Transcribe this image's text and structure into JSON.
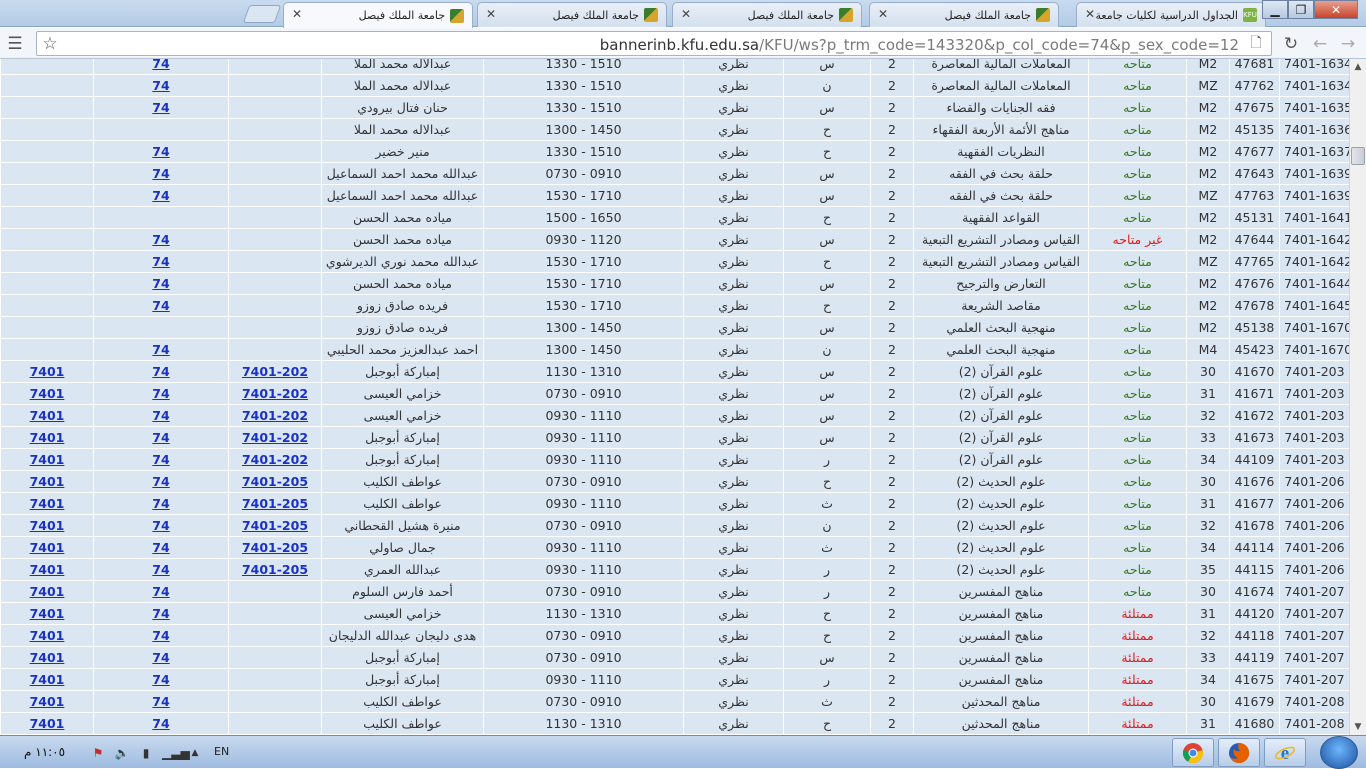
{
  "browser": {
    "tabs": [
      {
        "title": "الجداول الدراسية لكليات جامعة",
        "icon": "kfu-icon",
        "active": false
      },
      {
        "title": "جامعة الملك فيصل",
        "icon": "kfu-logo-icon",
        "active": false
      },
      {
        "title": "جامعة الملك فيصل",
        "icon": "kfu-logo-icon",
        "active": false
      },
      {
        "title": "جامعة الملك فيصل",
        "icon": "kfu-logo-icon",
        "active": false
      },
      {
        "title": "جامعة الملك فيصل",
        "icon": "kfu-logo-icon",
        "active": true
      }
    ],
    "url_host": "bannerinb.kfu.edu.sa",
    "url_rest": "/KFU/ws?p_trm_code=143320&p_col_code=74&p_sex_code=12"
  },
  "status_colors": {
    "available": "#3a7a1e",
    "unavailable": "#e01b1b"
  },
  "rows": [
    {
      "course": "7401-1634",
      "crn": "47681",
      "section": "M2",
      "status": "متاحه",
      "status_type": "a",
      "title": "المعاملات المالية المعاصرة",
      "credits": "2",
      "day": "س",
      "type": "نظري",
      "time": "1330 - 1510",
      "instructor": "عبدالاله محمد الملا",
      "college": "74",
      "link1": "",
      "link2": ""
    },
    {
      "course": "7401-1634",
      "crn": "47762",
      "section": "MZ",
      "status": "متاحه",
      "status_type": "a",
      "title": "المعاملات المالية المعاصرة",
      "credits": "2",
      "day": "ن",
      "type": "نظري",
      "time": "1330 - 1510",
      "instructor": "عبدالاله محمد الملا",
      "college": "74",
      "link1": "",
      "link2": ""
    },
    {
      "course": "7401-1635",
      "crn": "47675",
      "section": "M2",
      "status": "متاحه",
      "status_type": "a",
      "title": "فقه الجنايات والقضاء",
      "credits": "2",
      "day": "س",
      "type": "نظري",
      "time": "1330 - 1510",
      "instructor": "حنان فتال بيرودي",
      "college": "74",
      "link1": "",
      "link2": ""
    },
    {
      "course": "7401-1636",
      "crn": "45135",
      "section": "M2",
      "status": "متاحه",
      "status_type": "a",
      "title": "مناهج الأئمة الأربعة الفقهاء",
      "credits": "2",
      "day": "ح",
      "type": "نظري",
      "time": "1300 - 1450",
      "instructor": "عبدالاله محمد الملا",
      "college": "",
      "link1": "",
      "link2": ""
    },
    {
      "course": "7401-1637",
      "crn": "47677",
      "section": "M2",
      "status": "متاحه",
      "status_type": "a",
      "title": "النظريات الفقهية",
      "credits": "2",
      "day": "ح",
      "type": "نظري",
      "time": "1330 - 1510",
      "instructor": "منير خضير",
      "college": "74",
      "link1": "",
      "link2": ""
    },
    {
      "course": "7401-1639",
      "crn": "47643",
      "section": "M2",
      "status": "متاحه",
      "status_type": "a",
      "title": "حلقة بحث في الفقه",
      "credits": "2",
      "day": "س",
      "type": "نظري",
      "time": "0730 - 0910",
      "instructor": "عبدالله محمد احمد السماعيل",
      "college": "74",
      "link1": "",
      "link2": ""
    },
    {
      "course": "7401-1639",
      "crn": "47763",
      "section": "MZ",
      "status": "متاحه",
      "status_type": "a",
      "title": "حلقة بحث في الفقه",
      "credits": "2",
      "day": "س",
      "type": "نظري",
      "time": "1530 - 1710",
      "instructor": "عبدالله محمد احمد السماعيل",
      "college": "74",
      "link1": "",
      "link2": ""
    },
    {
      "course": "7401-1641",
      "crn": "45131",
      "section": "M2",
      "status": "متاحه",
      "status_type": "a",
      "title": "القواعد الفقهية",
      "credits": "2",
      "day": "ح",
      "type": "نظري",
      "time": "1500 - 1650",
      "instructor": "مياده محمد الحسن",
      "college": "",
      "link1": "",
      "link2": ""
    },
    {
      "course": "7401-1642",
      "crn": "47644",
      "section": "M2",
      "status": "غير متاحه",
      "status_type": "na",
      "title": "القياس ومصادر التشريع التبعية",
      "credits": "2",
      "day": "س",
      "type": "نظري",
      "time": "0930 - 1120",
      "instructor": "مياده محمد الحسن",
      "college": "74",
      "link1": "",
      "link2": ""
    },
    {
      "course": "7401-1642",
      "crn": "47765",
      "section": "MZ",
      "status": "متاحه",
      "status_type": "a",
      "title": "القياس ومصادر التشريع التبعية",
      "credits": "2",
      "day": "ح",
      "type": "نظري",
      "time": "1530 - 1710",
      "instructor": "عبدالله محمد نوري الديرشوي",
      "college": "74",
      "link1": "",
      "link2": ""
    },
    {
      "course": "7401-1644",
      "crn": "47676",
      "section": "M2",
      "status": "متاحه",
      "status_type": "a",
      "title": "التعارض والترجيح",
      "credits": "2",
      "day": "س",
      "type": "نظري",
      "time": "1530 - 1710",
      "instructor": "مياده محمد الحسن",
      "college": "74",
      "link1": "",
      "link2": ""
    },
    {
      "course": "7401-1645",
      "crn": "47678",
      "section": "M2",
      "status": "متاحه",
      "status_type": "a",
      "title": "مقاصد الشريعة",
      "credits": "2",
      "day": "ح",
      "type": "نظري",
      "time": "1530 - 1710",
      "instructor": "فريده صادق زوزو",
      "college": "74",
      "link1": "",
      "link2": ""
    },
    {
      "course": "7401-1670",
      "crn": "45138",
      "section": "M2",
      "status": "متاحه",
      "status_type": "a",
      "title": "منهجية البحث العلمي",
      "credits": "2",
      "day": "س",
      "type": "نظري",
      "time": "1300 - 1450",
      "instructor": "فريده صادق زوزو",
      "college": "",
      "link1": "",
      "link2": ""
    },
    {
      "course": "7401-1670",
      "crn": "45423",
      "section": "M4",
      "status": "متاحه",
      "status_type": "a",
      "title": "منهجية البحث العلمي",
      "credits": "2",
      "day": "ن",
      "type": "نظري",
      "time": "1300 - 1450",
      "instructor": "احمد عبدالعزيز محمد الحليبي",
      "college": "74",
      "link1": "",
      "link2": ""
    },
    {
      "course": "7401-203",
      "crn": "41670",
      "section": "30",
      "status": "متاحه",
      "status_type": "a",
      "title": "علوم القرآن (2)",
      "credits": "2",
      "day": "س",
      "type": "نظري",
      "time": "1130 - 1310",
      "instructor": "إمباركة أبوجبل",
      "college": "74",
      "link1": "7401-202",
      "link2": "7401"
    },
    {
      "course": "7401-203",
      "crn": "41671",
      "section": "31",
      "status": "متاحه",
      "status_type": "a",
      "title": "علوم القرآن (2)",
      "credits": "2",
      "day": "س",
      "type": "نظري",
      "time": "0730 - 0910",
      "instructor": "خزامي العيسى",
      "college": "74",
      "link1": "7401-202",
      "link2": "7401"
    },
    {
      "course": "7401-203",
      "crn": "41672",
      "section": "32",
      "status": "متاحه",
      "status_type": "a",
      "title": "علوم القرآن (2)",
      "credits": "2",
      "day": "س",
      "type": "نظري",
      "time": "0930 - 1110",
      "instructor": "خزامي العيسى",
      "college": "74",
      "link1": "7401-202",
      "link2": "7401"
    },
    {
      "course": "7401-203",
      "crn": "41673",
      "section": "33",
      "status": "متاحه",
      "status_type": "a",
      "title": "علوم القرآن (2)",
      "credits": "2",
      "day": "س",
      "type": "نظري",
      "time": "0930 - 1110",
      "instructor": "إمباركة أبوجبل",
      "college": "74",
      "link1": "7401-202",
      "link2": "7401"
    },
    {
      "course": "7401-203",
      "crn": "44109",
      "section": "34",
      "status": "متاحه",
      "status_type": "a",
      "title": "علوم القرآن (2)",
      "credits": "2",
      "day": "ر",
      "type": "نظري",
      "time": "0930 - 1110",
      "instructor": "إمباركة أبوجبل",
      "college": "74",
      "link1": "7401-202",
      "link2": "7401"
    },
    {
      "course": "7401-206",
      "crn": "41676",
      "section": "30",
      "status": "متاحه",
      "status_type": "a",
      "title": "علوم الحديث (2)",
      "credits": "2",
      "day": "ح",
      "type": "نظري",
      "time": "0730 - 0910",
      "instructor": "عواطف الكليب",
      "college": "74",
      "link1": "7401-205",
      "link2": "7401"
    },
    {
      "course": "7401-206",
      "crn": "41677",
      "section": "31",
      "status": "متاحه",
      "status_type": "a",
      "title": "علوم الحديث (2)",
      "credits": "2",
      "day": "ث",
      "type": "نظري",
      "time": "0930 - 1110",
      "instructor": "عواطف الكليب",
      "college": "74",
      "link1": "7401-205",
      "link2": "7401"
    },
    {
      "course": "7401-206",
      "crn": "41678",
      "section": "32",
      "status": "متاحه",
      "status_type": "a",
      "title": "علوم الحديث (2)",
      "credits": "2",
      "day": "ن",
      "type": "نظري",
      "time": "0730 - 0910",
      "instructor": "منيرة هشيل القحطاني",
      "college": "74",
      "link1": "7401-205",
      "link2": "7401"
    },
    {
      "course": "7401-206",
      "crn": "44114",
      "section": "34",
      "status": "متاحه",
      "status_type": "a",
      "title": "علوم الحديث (2)",
      "credits": "2",
      "day": "ث",
      "type": "نظري",
      "time": "0930 - 1110",
      "instructor": "جمال صاولي",
      "college": "74",
      "link1": "7401-205",
      "link2": "7401"
    },
    {
      "course": "7401-206",
      "crn": "44115",
      "section": "35",
      "status": "متاحه",
      "status_type": "a",
      "title": "علوم الحديث (2)",
      "credits": "2",
      "day": "ر",
      "type": "نظري",
      "time": "0930 - 1110",
      "instructor": "عبدالله العمري",
      "college": "74",
      "link1": "7401-205",
      "link2": "7401"
    },
    {
      "course": "7401-207",
      "crn": "41674",
      "section": "30",
      "status": "متاحه",
      "status_type": "a",
      "title": "مناهج المفسرين",
      "credits": "2",
      "day": "ر",
      "type": "نظري",
      "time": "0730 - 0910",
      "instructor": "أحمد فارس السلوم",
      "college": "74",
      "link1": "",
      "link2": "7401"
    },
    {
      "course": "7401-207",
      "crn": "44120",
      "section": "31",
      "status": "ممتلئة",
      "status_type": "na",
      "title": "مناهج المفسرين",
      "credits": "2",
      "day": "ح",
      "type": "نظري",
      "time": "1130 - 1310",
      "instructor": "خزامي العيسى",
      "college": "74",
      "link1": "",
      "link2": "7401"
    },
    {
      "course": "7401-207",
      "crn": "44118",
      "section": "32",
      "status": "ممتلئة",
      "status_type": "na",
      "title": "مناهج المفسرين",
      "credits": "2",
      "day": "ح",
      "type": "نظري",
      "time": "0730 - 0910",
      "instructor": "هدى دليجان عبدالله الدليجان",
      "college": "74",
      "link1": "",
      "link2": "7401"
    },
    {
      "course": "7401-207",
      "crn": "44119",
      "section": "33",
      "status": "ممتلئة",
      "status_type": "na",
      "title": "مناهج المفسرين",
      "credits": "2",
      "day": "س",
      "type": "نظري",
      "time": "0730 - 0910",
      "instructor": "إمباركة أبوجبل",
      "college": "74",
      "link1": "",
      "link2": "7401"
    },
    {
      "course": "7401-207",
      "crn": "41675",
      "section": "34",
      "status": "ممتلئة",
      "status_type": "na",
      "title": "مناهج المفسرين",
      "credits": "2",
      "day": "ر",
      "type": "نظري",
      "time": "0930 - 1110",
      "instructor": "إمباركة أبوجبل",
      "college": "74",
      "link1": "",
      "link2": "7401"
    },
    {
      "course": "7401-208",
      "crn": "41679",
      "section": "30",
      "status": "ممتلئة",
      "status_type": "na",
      "title": "مناهج المحدثين",
      "credits": "2",
      "day": "ث",
      "type": "نظري",
      "time": "0730 - 0910",
      "instructor": "عواطف الكليب",
      "college": "74",
      "link1": "",
      "link2": "7401"
    },
    {
      "course": "7401-208",
      "crn": "41680",
      "section": "31",
      "status": "ممتلئة",
      "status_type": "na",
      "title": "مناهج المحدثين",
      "credits": "2",
      "day": "ح",
      "type": "نظري",
      "time": "1130 - 1310",
      "instructor": "عواطف الكليب",
      "college": "74",
      "link1": "",
      "link2": "7401"
    }
  ],
  "taskbar": {
    "clock": "١١:٠٥ م",
    "language": "EN",
    "apps": [
      "chrome-icon",
      "firefox-icon",
      "ie-icon"
    ]
  }
}
